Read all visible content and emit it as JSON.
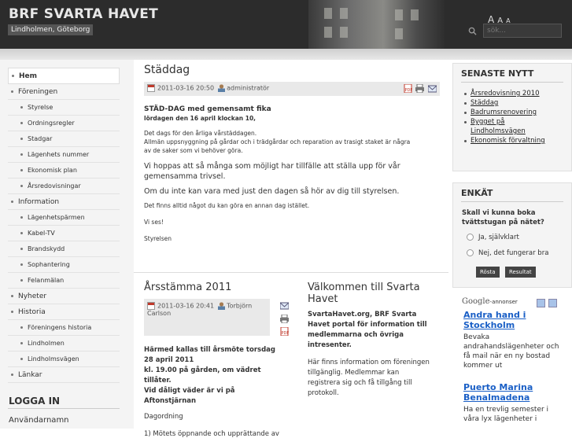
{
  "header": {
    "title": "BRF SVARTA HAVET",
    "subtitle": "Lindholmen, Göteborg",
    "font_sizes": [
      "A",
      "A",
      "A"
    ],
    "search_placeholder": "sök..."
  },
  "nav": {
    "items": [
      {
        "label": "Hem",
        "level": 0,
        "active": true
      },
      {
        "label": "Föreningen",
        "level": 0
      },
      {
        "label": "Styrelse",
        "level": 1
      },
      {
        "label": "Ordningsregler",
        "level": 1
      },
      {
        "label": "Stadgar",
        "level": 1
      },
      {
        "label": "Lägenhets nummer",
        "level": 1
      },
      {
        "label": "Ekonomisk plan",
        "level": 1
      },
      {
        "label": "Årsredovisningar",
        "level": 1
      },
      {
        "label": "Information",
        "level": 0
      },
      {
        "label": "Lägenhetspärmen",
        "level": 1
      },
      {
        "label": "Kabel-TV",
        "level": 1
      },
      {
        "label": "Brandskydd",
        "level": 1
      },
      {
        "label": "Sophantering",
        "level": 1
      },
      {
        "label": "Felanmälan",
        "level": 1
      },
      {
        "label": "Nyheter",
        "level": 0
      },
      {
        "label": "Historia",
        "level": 0
      },
      {
        "label": "Föreningens historia",
        "level": 1
      },
      {
        "label": "Lindholmen",
        "level": 1
      },
      {
        "label": "Lindholmsvägen",
        "level": 1
      },
      {
        "label": "Länkar",
        "level": 0
      }
    ]
  },
  "login": {
    "title": "LOGGA IN",
    "username_label": "Användarnamn"
  },
  "article": {
    "title": "Städdag",
    "date": "2011-03-16 20:50",
    "author": "administratör",
    "heading": "STÄD-DAG med gemensamt fika",
    "subheading": "lördagen den 16 april klockan 10,",
    "p1a": "Det dags för den årliga vårstäddagen.",
    "p1b": "Allmän uppsnyggning på gårdar och i trädgårdar och reparation av trasigt staket är några",
    "p1c": "av de saker som vi behöver göra.",
    "p2": "Vi hoppas att så många som möjligt har tillfälle att ställa upp för vår gemensamma trivsel.",
    "p3": "Om du inte kan vara med just den dagen så hör av dig till styrelsen.",
    "p4": "Det finns alltid något du kan göra en annan dag istället.",
    "p5": "Vi ses!",
    "p6": "Styrelsen"
  },
  "article2": {
    "title": "Årsstämma 2011",
    "date": "2011-03-16 20:41",
    "author": "Torbjörn",
    "author2": "Carlson",
    "b1": "Härmed kallas till årsmöte torsdag 28 april 2011",
    "b2": "kl. 19.00 på gården, om vädret tillåter.",
    "b3": "Vid dåligt väder är vi på Aftonstjärnan",
    "agenda": "Dagordning",
    "item1": "1) Mötets öppnande och upprättande av"
  },
  "article3": {
    "title": "Välkommen till Svarta Havet",
    "bold": "SvartaHavet.org, BRF Svarta Havet portal för information till medlemmarna och övriga intresenter.",
    "text": "Här finns information om föreningen tillgänglig. Medlemmar kan registrera sig och få tillgång till protokoll."
  },
  "latest": {
    "title": "SENASTE NYTT",
    "items": [
      "Årsredovisning 2010",
      "Städdag",
      "Badrumsrenovering",
      "Bygget på Lindholmsvägen",
      "Ekonomisk förvaltning"
    ]
  },
  "poll": {
    "title": "ENKÄT",
    "question": "Skall vi kunna boka tvättstugan på nätet?",
    "options": [
      "Ja, självklart",
      "Nej, det fungerar bra"
    ],
    "vote_label": "Rösta",
    "results_label": "Resultat"
  },
  "ads": {
    "brand": "Google",
    "label": "-annonser",
    "items": [
      {
        "title": "Andra hand i Stockholm",
        "text": "Bevaka andrahandslägenheter och få mail när en ny bostad kommer ut"
      },
      {
        "title": "Puerto Marina Benalmadena",
        "text": "Ha en trevlig semester i våra lyx lägenheter i"
      }
    ]
  },
  "colors": {
    "header_bg": "#2c2c2c",
    "link_blue": "#1a5fc6",
    "sidebar_bg": "#f4f4f4"
  }
}
